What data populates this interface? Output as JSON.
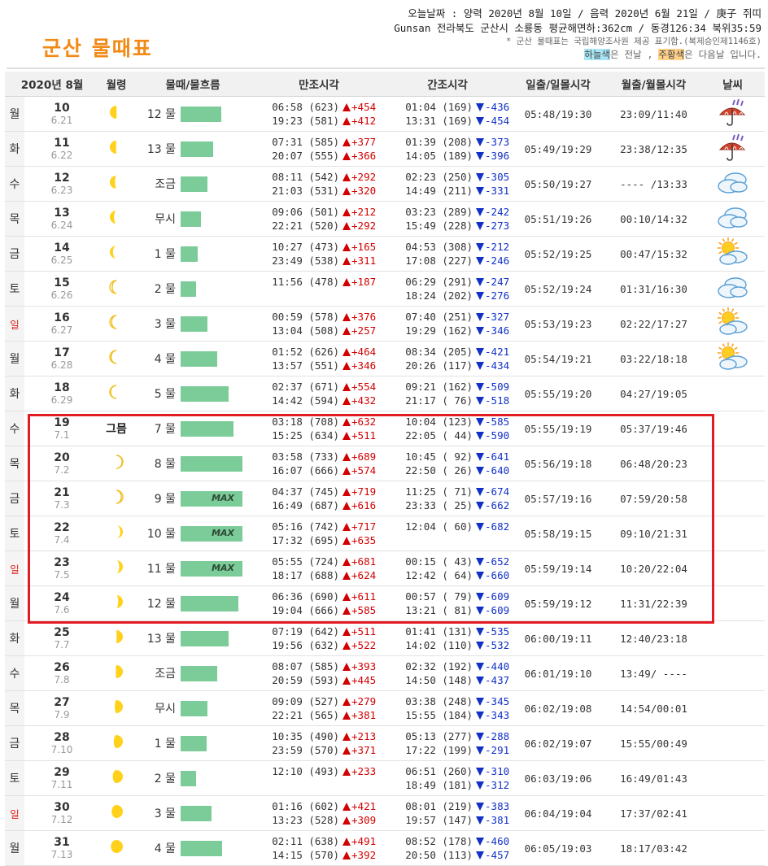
{
  "page": {
    "title": "군산 물때표",
    "info_line1": "오늘날짜 : 양력 2020년 8월 10일 / 음력 2020년 6월 21일 / 庚子 쥐띠",
    "info_line2": "Gunsan 전라북도 군산시 소룡동 평균해면하:362cm / 동경126:34 북위35:59",
    "info_note": "* 군산 물때표는 국립해양조사원 제공 표기함.(복제승인제1146호)",
    "legend_sky": "하늘색",
    "legend_mid": "은 전날 , ",
    "legend_orange": "주황색",
    "legend_end": "은 다음날 입니다."
  },
  "colors": {
    "title": "#f28a16",
    "bar": "#7ccc9a",
    "flood": "#d20000",
    "ebb": "#1030c8",
    "highlight_box": "#e21b23",
    "sunday": "#d22222"
  },
  "table": {
    "headers": {
      "date": "2020년  8월",
      "moon": "월령",
      "tide": "물때/물흐름",
      "high": "만조시각",
      "low": "간조시각",
      "sun": "일출/일몰시각",
      "moonrise": "월출/월몰시각",
      "weather": "날씨"
    },
    "rows": [
      {
        "dow": "월",
        "sunday": false,
        "day": "10",
        "lunar": "6.21",
        "moon_icon": "moon-gibbous-icon",
        "moon_phase": 0.74,
        "moon_label": "",
        "tide": "12 물",
        "flow": 0.66,
        "max": "",
        "high": [
          "06:58 (623)",
          "19:23 (581)"
        ],
        "high_diff": [
          "+454",
          "+412"
        ],
        "low": [
          "01:04 (169)",
          "13:31 (169)"
        ],
        "low_diff": [
          "-436",
          "-454"
        ],
        "sun": "05:48/19:30",
        "moonrise": "23:09/11:40",
        "weather": "rain-icon"
      },
      {
        "dow": "화",
        "sunday": false,
        "day": "11",
        "lunar": "6.22",
        "moon_icon": "moon-half-icon",
        "moon_phase": 0.76,
        "moon_label": "",
        "tide": "13 물",
        "flow": 0.52,
        "max": "",
        "high": [
          "07:31 (585)",
          "20:07 (555)"
        ],
        "high_diff": [
          "+377",
          "+366"
        ],
        "low": [
          "01:39 (208)",
          "14:05 (189)"
        ],
        "low_diff": [
          "-373",
          "-396"
        ],
        "sun": "05:49/19:29",
        "moonrise": "23:38/12:35",
        "weather": "rain-icon"
      },
      {
        "dow": "수",
        "sunday": false,
        "day": "12",
        "lunar": "6.23",
        "moon_icon": "moon-crescent-icon",
        "moon_phase": 0.8,
        "moon_label": "",
        "tide": "조금",
        "flow": 0.44,
        "max": "",
        "high": [
          "08:11 (542)",
          "21:03 (531)"
        ],
        "high_diff": [
          "+292",
          "+320"
        ],
        "low": [
          "02:23 (250)",
          "14:49 (211)"
        ],
        "low_diff": [
          "-305",
          "-331"
        ],
        "sun": "05:50/19:27",
        "moonrise": "---- /13:33",
        "weather": "cloud-icon"
      },
      {
        "dow": "목",
        "sunday": false,
        "day": "13",
        "lunar": "6.24",
        "moon_icon": "moon-crescent-icon",
        "moon_phase": 0.84,
        "moon_label": "",
        "tide": "무시",
        "flow": 0.33,
        "max": "",
        "high": [
          "09:06 (501)",
          "22:21 (520)"
        ],
        "high_diff": [
          "+212",
          "+292"
        ],
        "low": [
          "03:23 (289)",
          "15:49 (228)"
        ],
        "low_diff": [
          "-242",
          "-273"
        ],
        "sun": "05:51/19:26",
        "moonrise": "00:10/14:32",
        "weather": "cloud-icon"
      },
      {
        "dow": "금",
        "sunday": false,
        "day": "14",
        "lunar": "6.25",
        "moon_icon": "moon-crescent-icon",
        "moon_phase": 0.88,
        "moon_label": "",
        "tide": "1 물",
        "flow": 0.27,
        "max": "",
        "high": [
          "10:27 (473)",
          "23:49 (538)"
        ],
        "high_diff": [
          "+165",
          "+311"
        ],
        "low": [
          "04:53 (308)",
          "17:08 (227)"
        ],
        "low_diff": [
          "-212",
          "-246"
        ],
        "sun": "05:52/19:25",
        "moonrise": "00:47/15:32",
        "weather": "sun-cloud-icon"
      },
      {
        "dow": "토",
        "sunday": false,
        "day": "15",
        "lunar": "6.26",
        "moon_icon": "moon-crescent-icon",
        "moon_phase": 0.91,
        "moon_label": "",
        "tide": "2 물",
        "flow": 0.25,
        "max": "",
        "high": [
          "11:56 (478)",
          ""
        ],
        "high_diff": [
          "+187",
          ""
        ],
        "low": [
          "06:29 (291)",
          "18:24 (202)"
        ],
        "low_diff": [
          "-247",
          "-276"
        ],
        "sun": "05:52/19:24",
        "moonrise": "01:31/16:30",
        "weather": "cloud-icon"
      },
      {
        "dow": "일",
        "sunday": true,
        "day": "16",
        "lunar": "6.27",
        "moon_icon": "moon-crescent-icon",
        "moon_phase": 0.93,
        "moon_label": "",
        "tide": "3 물",
        "flow": 0.44,
        "max": "",
        "high": [
          "00:59 (578)",
          "13:04 (508)"
        ],
        "high_diff": [
          "+376",
          "+257"
        ],
        "low": [
          "07:40 (251)",
          "19:29 (162)"
        ],
        "low_diff": [
          "-327",
          "-346"
        ],
        "sun": "05:53/19:23",
        "moonrise": "02:22/17:27",
        "weather": "sun-cloud-icon"
      },
      {
        "dow": "월",
        "sunday": false,
        "day": "17",
        "lunar": "6.28",
        "moon_icon": "moon-crescent-icon",
        "moon_phase": 0.95,
        "moon_label": "",
        "tide": "4 물",
        "flow": 0.59,
        "max": "",
        "high": [
          "01:52 (626)",
          "13:57 (551)"
        ],
        "high_diff": [
          "+464",
          "+346"
        ],
        "low": [
          "08:34 (205)",
          "20:26 (117)"
        ],
        "low_diff": [
          "-421",
          "-434"
        ],
        "sun": "05:54/19:21",
        "moonrise": "03:22/18:18",
        "weather": "sun-cloud-icon"
      },
      {
        "dow": "화",
        "sunday": false,
        "day": "18",
        "lunar": "6.29",
        "moon_icon": "moon-crescent-icon",
        "moon_phase": 0.97,
        "moon_label": "",
        "tide": "5 물",
        "flow": 0.77,
        "max": "",
        "high": [
          "02:37 (671)",
          "14:42 (594)"
        ],
        "high_diff": [
          "+554",
          "+432"
        ],
        "low": [
          "09:21 (162)",
          "21:17 ( 76)"
        ],
        "low_diff": [
          "-509",
          "-518"
        ],
        "sun": "05:55/19:20",
        "moonrise": "04:27/19:05",
        "weather": ""
      },
      {
        "dow": "수",
        "sunday": false,
        "day": "19",
        "lunar": "7.1",
        "moon_icon": "",
        "moon_phase": 0,
        "moon_label": "그믐",
        "tide": "7 물",
        "flow": 0.85,
        "max": "",
        "high": [
          "03:18 (708)",
          "15:25 (634)"
        ],
        "high_diff": [
          "+632",
          "+511"
        ],
        "low": [
          "10:04 (123)",
          "22:05 ( 44)"
        ],
        "low_diff": [
          "-585",
          "-590"
        ],
        "sun": "05:55/19:19",
        "moonrise": "05:37/19:46",
        "weather": ""
      },
      {
        "dow": "목",
        "sunday": false,
        "day": "20",
        "lunar": "7.2",
        "moon_icon": "moon-new-crescent-icon",
        "moon_phase": 0.03,
        "moon_label": "",
        "tide": "8 물",
        "flow": 1.0,
        "max": "",
        "high": [
          "03:58 (733)",
          "16:07 (666)"
        ],
        "high_diff": [
          "+689",
          "+574"
        ],
        "low": [
          "10:45 ( 92)",
          "22:50 ( 26)"
        ],
        "low_diff": [
          "-641",
          "-640"
        ],
        "sun": "05:56/19:18",
        "moonrise": "06:48/20:23",
        "weather": ""
      },
      {
        "dow": "금",
        "sunday": false,
        "day": "21",
        "lunar": "7.3",
        "moon_icon": "moon-new-crescent-icon",
        "moon_phase": 0.06,
        "moon_label": "",
        "tide": "9 물",
        "flow": 1.0,
        "max": "MAX",
        "high": [
          "04:37 (745)",
          "16:49 (687)"
        ],
        "high_diff": [
          "+719",
          "+616"
        ],
        "low": [
          "11:25 ( 71)",
          "23:33 ( 25)"
        ],
        "low_diff": [
          "-674",
          "-662"
        ],
        "sun": "05:57/19:16",
        "moonrise": "07:59/20:58",
        "weather": ""
      },
      {
        "dow": "토",
        "sunday": false,
        "day": "22",
        "lunar": "7.4",
        "moon_icon": "moon-new-crescent-icon",
        "moon_phase": 0.1,
        "moon_label": "",
        "tide": "10 물",
        "flow": 1.0,
        "max": "MAX",
        "high": [
          "05:16 (742)",
          "17:32 (695)"
        ],
        "high_diff": [
          "+717",
          "+635"
        ],
        "low": [
          "12:04 ( 60)",
          ""
        ],
        "low_diff": [
          "-682",
          ""
        ],
        "sun": "05:58/19:15",
        "moonrise": "09:10/21:31",
        "weather": ""
      },
      {
        "dow": "일",
        "sunday": true,
        "day": "23",
        "lunar": "7.5",
        "moon_icon": "moon-new-crescent-icon",
        "moon_phase": 0.14,
        "moon_label": "",
        "tide": "11 물",
        "flow": 1.0,
        "max": "MAX",
        "high": [
          "05:55 (724)",
          "18:17 (688)"
        ],
        "high_diff": [
          "+681",
          "+624"
        ],
        "low": [
          "00:15 ( 43)",
          "12:42 ( 64)"
        ],
        "low_diff": [
          "-652",
          "-660"
        ],
        "sun": "05:59/19:14",
        "moonrise": "10:20/22:04",
        "weather": ""
      },
      {
        "dow": "월",
        "sunday": false,
        "day": "24",
        "lunar": "7.6",
        "moon_icon": "moon-new-crescent-icon",
        "moon_phase": 0.18,
        "moon_label": "",
        "tide": "12 물",
        "flow": 0.93,
        "max": "",
        "high": [
          "06:36 (690)",
          "19:04 (666)"
        ],
        "high_diff": [
          "+611",
          "+585"
        ],
        "low": [
          "00:57 ( 79)",
          "13:21 ( 81)"
        ],
        "low_diff": [
          "-609",
          "-609"
        ],
        "sun": "05:59/19:12",
        "moonrise": "11:31/22:39",
        "weather": ""
      },
      {
        "dow": "화",
        "sunday": false,
        "day": "25",
        "lunar": "7.7",
        "moon_icon": "moon-half-icon",
        "moon_phase": 0.24,
        "moon_label": "",
        "tide": "13 물",
        "flow": 0.77,
        "max": "",
        "high": [
          "07:19 (642)",
          "19:56 (632)"
        ],
        "high_diff": [
          "+511",
          "+522"
        ],
        "low": [
          "01:41 (131)",
          "14:02 (110)"
        ],
        "low_diff": [
          "-535",
          "-532"
        ],
        "sun": "06:00/19:11",
        "moonrise": "12:40/23:18",
        "weather": ""
      },
      {
        "dow": "수",
        "sunday": false,
        "day": "26",
        "lunar": "7.8",
        "moon_icon": "moon-half-icon",
        "moon_phase": 0.27,
        "moon_label": "",
        "tide": "조금",
        "flow": 0.59,
        "max": "",
        "high": [
          "08:07 (585)",
          "20:59 (593)"
        ],
        "high_diff": [
          "+393",
          "+445"
        ],
        "low": [
          "02:32 (192)",
          "14:50 (148)"
        ],
        "low_diff": [
          "-440",
          "-437"
        ],
        "sun": "06:01/19:10",
        "moonrise": "13:49/ ----",
        "weather": ""
      },
      {
        "dow": "목",
        "sunday": false,
        "day": "27",
        "lunar": "7.9",
        "moon_icon": "moon-gibbous-icon",
        "moon_phase": 0.31,
        "moon_label": "",
        "tide": "무시",
        "flow": 0.44,
        "max": "",
        "high": [
          "09:09 (527)",
          "22:21 (565)"
        ],
        "high_diff": [
          "+279",
          "+381"
        ],
        "low": [
          "03:38 (248)",
          "15:55 (184)"
        ],
        "low_diff": [
          "-345",
          "-343"
        ],
        "sun": "06:02/19:08",
        "moonrise": "14:54/00:01",
        "weather": ""
      },
      {
        "dow": "금",
        "sunday": false,
        "day": "28",
        "lunar": "7.10",
        "moon_icon": "moon-gibbous-icon",
        "moon_phase": 0.35,
        "moon_label": "",
        "tide": "1 물",
        "flow": 0.42,
        "max": "",
        "high": [
          "10:35 (490)",
          "23:59 (570)"
        ],
        "high_diff": [
          "+213",
          "+371"
        ],
        "low": [
          "05:13 (277)",
          "17:22 (199)"
        ],
        "low_diff": [
          "-288",
          "-291"
        ],
        "sun": "06:02/19:07",
        "moonrise": "15:55/00:49",
        "weather": ""
      },
      {
        "dow": "토",
        "sunday": false,
        "day": "29",
        "lunar": "7.11",
        "moon_icon": "moon-gibbous-icon",
        "moon_phase": 0.39,
        "moon_label": "",
        "tide": "2 물",
        "flow": 0.25,
        "max": "",
        "high": [
          "12:10 (493)",
          ""
        ],
        "high_diff": [
          "+233",
          ""
        ],
        "low": [
          "06:51 (260)",
          "18:49 (181)"
        ],
        "low_diff": [
          "-310",
          "-312"
        ],
        "sun": "06:03/19:06",
        "moonrise": "16:49/01:43",
        "weather": ""
      },
      {
        "dow": "일",
        "sunday": true,
        "day": "30",
        "lunar": "7.12",
        "moon_icon": "moon-gibbous-icon",
        "moon_phase": 0.43,
        "moon_label": "",
        "tide": "3 물",
        "flow": 0.5,
        "max": "",
        "high": [
          "01:16 (602)",
          "13:23 (528)"
        ],
        "high_diff": [
          "+421",
          "+309"
        ],
        "low": [
          "08:01 (219)",
          "19:57 (147)"
        ],
        "low_diff": [
          "-383",
          "-381"
        ],
        "sun": "06:04/19:04",
        "moonrise": "17:37/02:41",
        "weather": ""
      },
      {
        "dow": "월",
        "sunday": false,
        "day": "31",
        "lunar": "7.13",
        "moon_icon": "moon-full-icon",
        "moon_phase": 0.46,
        "moon_label": "",
        "tide": "4 물",
        "flow": 0.67,
        "max": "",
        "high": [
          "02:11 (638)",
          "14:15 (570)"
        ],
        "high_diff": [
          "+491",
          "+392"
        ],
        "low": [
          "08:52 (178)",
          "20:50 (113)"
        ],
        "low_diff": [
          "-460",
          "-457"
        ],
        "sun": "06:05/19:03",
        "moonrise": "18:17/03:42",
        "weather": ""
      }
    ]
  }
}
